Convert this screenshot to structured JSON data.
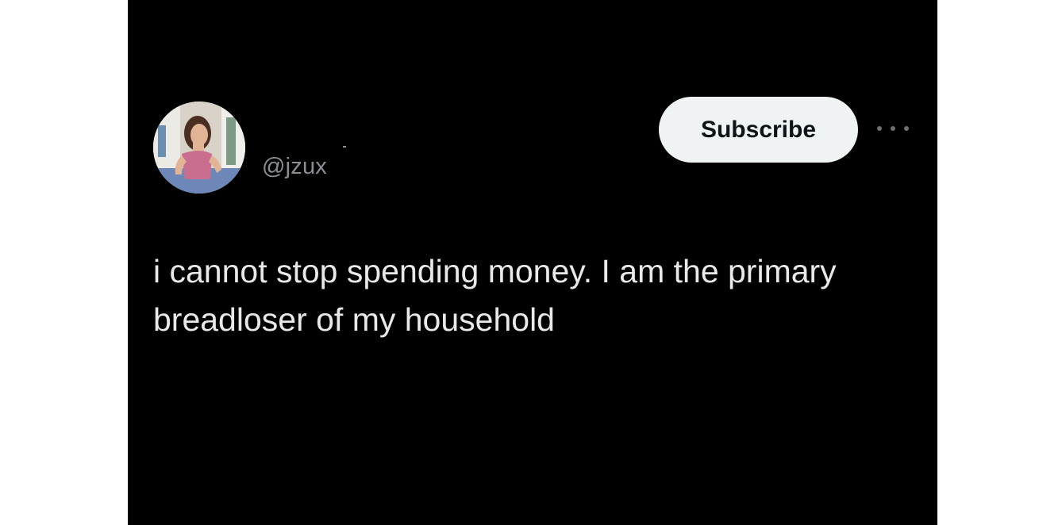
{
  "post": {
    "handle": "@jzux",
    "subscribe_label": "Subscribe",
    "more_icon": "more-horizontal-icon",
    "text": "i cannot stop spending money. I am the primary breadloser of my household"
  },
  "colors": {
    "background": "#000000",
    "text": "#e7e9ea",
    "handle": "#8b8f94",
    "button_bg": "#eff3f4",
    "button_text": "#0f1419"
  }
}
